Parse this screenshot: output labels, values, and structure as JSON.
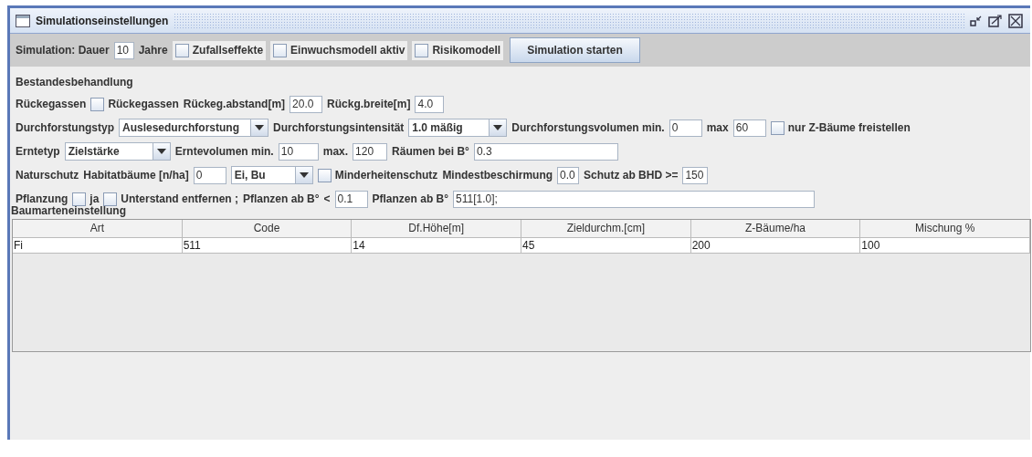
{
  "window": {
    "title": "Simulationseinstellungen"
  },
  "toolbar": [
    {
      "kind": "label",
      "text": "Simulation: Dauer"
    },
    {
      "kind": "field",
      "value": "10"
    },
    {
      "kind": "label",
      "text": "Jahre"
    },
    {
      "kind": "checkbox",
      "text": "Zufallseffekte",
      "checked": false
    },
    {
      "kind": "checkbox",
      "text": "Einwuchsmodell aktiv",
      "checked": false
    },
    {
      "kind": "checkbox",
      "text": "Risikomodell",
      "checked": false
    },
    {
      "kind": "button",
      "text": "Simulation starten"
    }
  ],
  "section_title": "Bestandesbehandlung",
  "rows": [
    [
      {
        "kind": "label",
        "text": "Rückegassen"
      },
      {
        "kind": "checkbox",
        "text": "Rückegassen",
        "checked": false
      },
      {
        "kind": "label",
        "text": "Rückeg.abstand[m]"
      },
      {
        "kind": "field",
        "value": "20.0"
      },
      {
        "kind": "label",
        "text": "Rückg.breite[m]"
      },
      {
        "kind": "field",
        "value": "4.0"
      }
    ],
    [
      {
        "kind": "label",
        "text": "Durchforstungstyp"
      },
      {
        "kind": "combo",
        "value": "Auslesedurchforstung"
      },
      {
        "kind": "label",
        "text": "Durchforstungsintensität"
      },
      {
        "kind": "combo",
        "value": "1.0 mäßig"
      },
      {
        "kind": "label",
        "text": "Durchforstungsvolumen min."
      },
      {
        "kind": "field",
        "value": "0"
      },
      {
        "kind": "label",
        "text": "max"
      },
      {
        "kind": "field",
        "value": "60"
      },
      {
        "kind": "checkbox",
        "text": "nur Z-Bäume freistellen",
        "checked": false
      }
    ],
    [
      {
        "kind": "label",
        "text": "Erntetyp"
      },
      {
        "kind": "combo",
        "value": "Zielstärke"
      },
      {
        "kind": "label",
        "text": "Erntevolumen min."
      },
      {
        "kind": "field",
        "value": "10"
      },
      {
        "kind": "label",
        "text": "max."
      },
      {
        "kind": "field",
        "value": "120"
      },
      {
        "kind": "label",
        "text": "Räumen bei B°"
      },
      {
        "kind": "field",
        "value": "0.3"
      }
    ],
    [
      {
        "kind": "label",
        "text": "Naturschutz"
      },
      {
        "kind": "label",
        "text": "Habitatbäume [n/ha]"
      },
      {
        "kind": "field",
        "value": "0"
      },
      {
        "kind": "combo",
        "value": "Ei, Bu"
      },
      {
        "kind": "checkbox",
        "text": "Minderheitenschutz",
        "checked": false
      },
      {
        "kind": "label",
        "text": "Mindestbeschirmung"
      },
      {
        "kind": "field",
        "value": "0.0"
      },
      {
        "kind": "label",
        "text": "Schutz ab BHD >="
      },
      {
        "kind": "field",
        "value": "150"
      }
    ],
    [
      {
        "kind": "label",
        "text": "Pflanzung"
      },
      {
        "kind": "checkbox",
        "text": "ja",
        "checked": false
      },
      {
        "kind": "checkbox",
        "text": "Unterstand entfernen ;",
        "checked": false
      },
      {
        "kind": "label",
        "text": "Pflanzen ab B°"
      },
      {
        "kind": "label",
        "text": "<"
      },
      {
        "kind": "field",
        "value": "0.1"
      },
      {
        "kind": "label",
        "text": "Pflanzen ab B°"
      },
      {
        "kind": "field",
        "value": "511[1.0];"
      }
    ]
  ],
  "table": {
    "title": "Baumarteneinstellung",
    "columns": [
      "Art",
      "Code",
      "Df.Höhe[m]",
      "Zieldurchm.[cm]",
      "Z-Bäume/ha",
      "Mischung %"
    ],
    "rows": [
      [
        "Fi",
        "511",
        "14",
        "45",
        "200",
        "100"
      ]
    ]
  }
}
